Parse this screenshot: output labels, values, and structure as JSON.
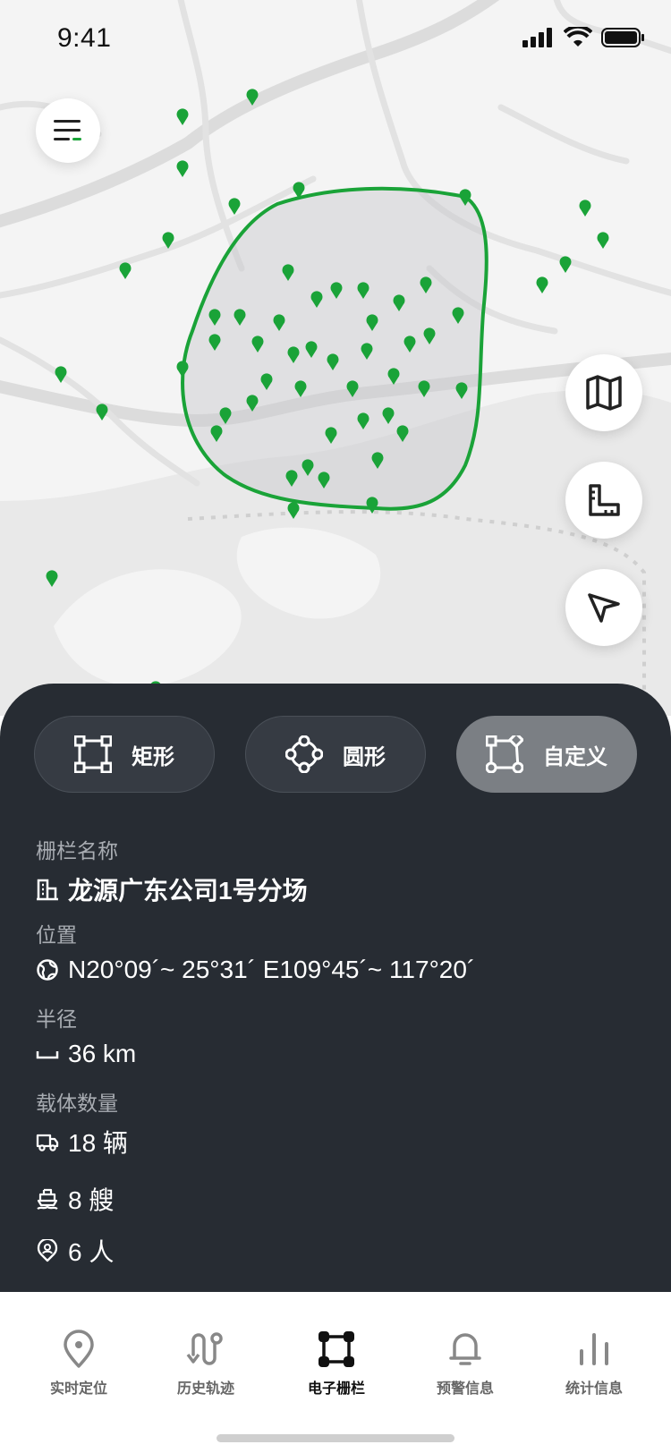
{
  "status_bar": {
    "time": "9:41"
  },
  "map": {
    "accent_color": "#1aa338",
    "fence_shape": "custom-polygon"
  },
  "fence_types": [
    {
      "label": "矩形",
      "icon": "rectangle-icon",
      "active": false
    },
    {
      "label": "圆形",
      "icon": "circle-nodes-icon",
      "active": false
    },
    {
      "label": "自定义",
      "icon": "custom-shape-icon",
      "active": true
    }
  ],
  "fence": {
    "name_label": "栅栏名称",
    "name": "龙源广东公司1号分场",
    "location_label": "位置",
    "location": "N20°09´~ 25°31´ E109°45´~ 117°20´",
    "radius_label": "半径",
    "radius": "36 km",
    "carriers_label": "载体数量",
    "vehicles": "18 辆",
    "ships": "8 艘",
    "people": "6 人"
  },
  "tabs": [
    {
      "label": "实时定位",
      "icon": "location-pin-icon"
    },
    {
      "label": "历史轨迹",
      "icon": "route-icon"
    },
    {
      "label": "电子栅栏",
      "icon": "fence-icon",
      "active": true
    },
    {
      "label": "预警信息",
      "icon": "bell-icon"
    },
    {
      "label": "统计信息",
      "icon": "bar-chart-icon"
    }
  ]
}
